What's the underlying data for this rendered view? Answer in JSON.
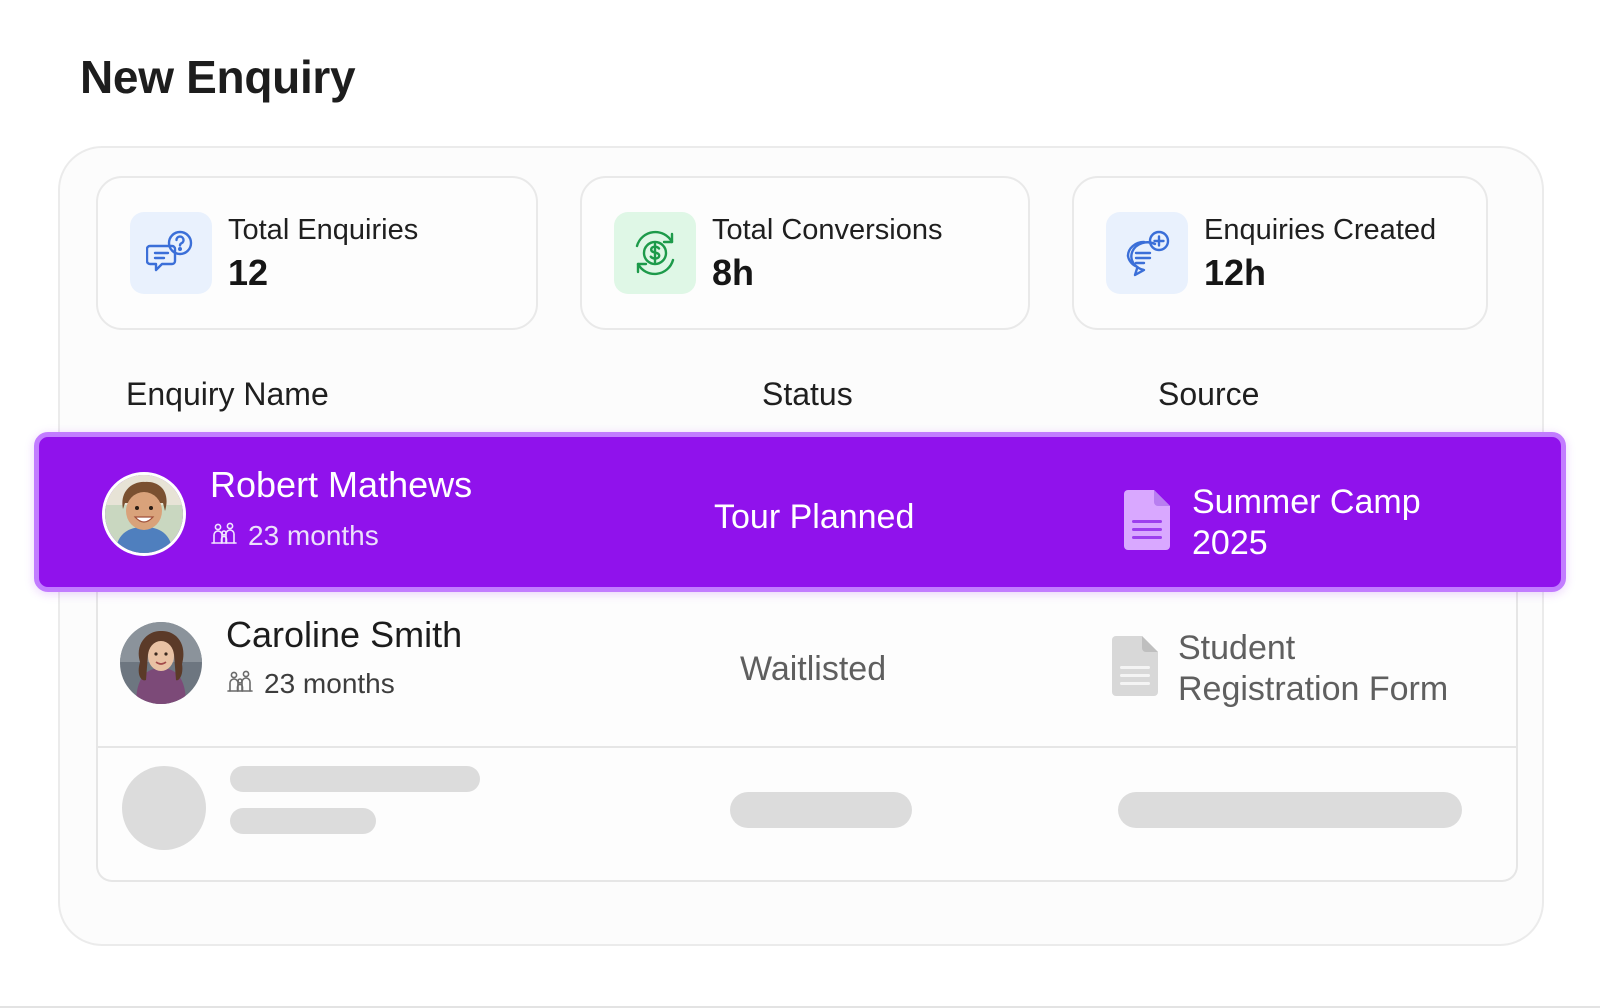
{
  "page": {
    "title": "New Enquiry"
  },
  "stats": [
    {
      "label": "Total Enquiries",
      "value": "12",
      "icon": "question-chat-icon",
      "color": "#3b6fd8"
    },
    {
      "label": "Total Conversions",
      "value": "8h",
      "icon": "dollar-cycle-icon",
      "color": "#1d9a4a"
    },
    {
      "label": "Enquiries Created",
      "value": "12h",
      "icon": "chat-plus-icon",
      "color": "#3b6fd8"
    }
  ],
  "table": {
    "headers": {
      "name": "Enquiry Name",
      "status": "Status",
      "source": "Source"
    },
    "rows": [
      {
        "name": "Robert Mathews",
        "age": "23 months",
        "status": "Tour Planned",
        "source_line1": "Summer Camp",
        "source_line2": "2025",
        "selected": true
      },
      {
        "name": "Caroline Smith",
        "age": "23 months",
        "status": "Waitlisted",
        "source_line1": "Student",
        "source_line2": "Registration Form",
        "selected": false
      }
    ]
  },
  "colors": {
    "highlight": "#9012ec",
    "highlight_border": "#c27cff",
    "skeleton": "#dcdcdc"
  }
}
